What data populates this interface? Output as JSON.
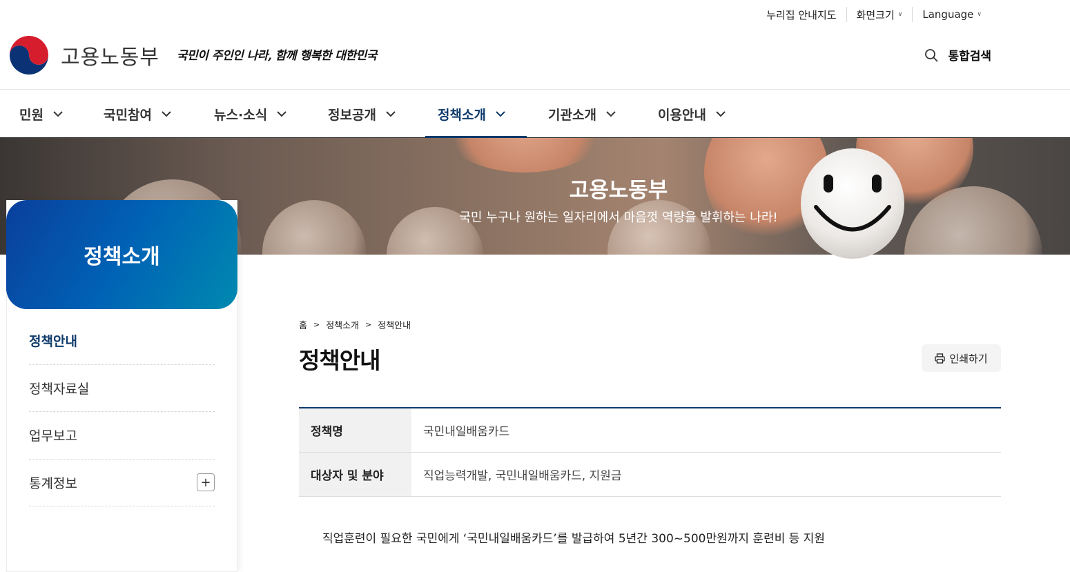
{
  "utility": {
    "sitemap": "누리집 안내지도",
    "font_size": "화면크기",
    "language": "Language"
  },
  "header": {
    "logo_text": "고용노동부",
    "slogan": "국민이 주인인 나라, 함께 행복한 대한민국",
    "search_label": "통합검색"
  },
  "gnb": {
    "items": [
      {
        "label": "민원"
      },
      {
        "label": "국민참여"
      },
      {
        "label": "뉴스·소식"
      },
      {
        "label": "정보공개"
      },
      {
        "label": "정책소개",
        "active": true
      },
      {
        "label": "기관소개"
      },
      {
        "label": "이용안내"
      }
    ]
  },
  "banner": {
    "title": "고용노동부",
    "subtitle": "국민 누구나 원하는 일자리에서 마음껏 역량을 발휘하는 나라!"
  },
  "lnb": {
    "title": "정책소개",
    "items": [
      {
        "label": "정책안내",
        "active": true
      },
      {
        "label": "정책자료실"
      },
      {
        "label": "업무보고"
      },
      {
        "label": "통계정보",
        "expandable": true
      }
    ]
  },
  "breadcrumb": [
    "홈",
    "정책소개",
    "정책안내"
  ],
  "page": {
    "title": "정책안내",
    "print_label": "인쇄하기"
  },
  "table": {
    "rows": [
      {
        "header": "정책명",
        "value": "국민내일배움카드"
      },
      {
        "header": "대상자 및 분야",
        "value": "직업능력개발, 국민내일배움카드, 지원금"
      }
    ]
  },
  "description": "직업훈련이 필요한 국민에게 ‘국민내일배움카드’를 발급하여 5년간 300~500만원까지 훈련비 등 지원",
  "colors": {
    "primary_navy": "#0d3a6a",
    "lnb_gradient_start": "#0a3f9c",
    "lnb_gradient_end": "#0089b0"
  },
  "icons": {
    "search": "search-icon",
    "print": "printer-icon",
    "expand": "plus-icon",
    "dropdown": "chevron-down-icon"
  }
}
